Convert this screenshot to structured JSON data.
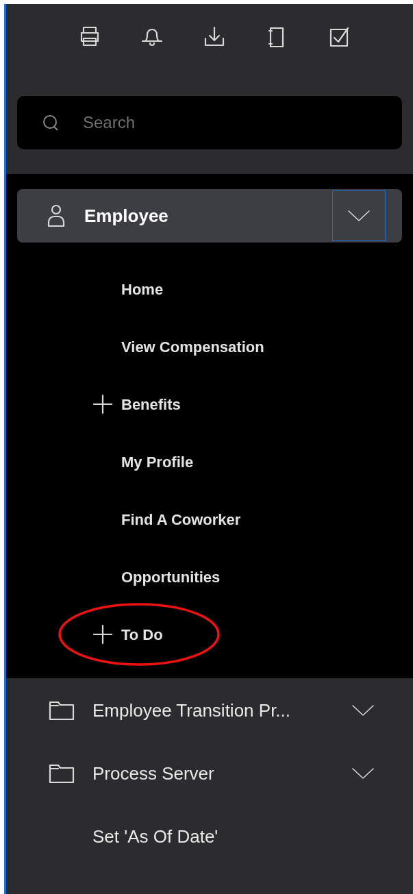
{
  "toolbar": [
    {
      "kind": "print"
    },
    {
      "kind": "bell"
    },
    {
      "kind": "download"
    },
    {
      "kind": "notebook"
    },
    {
      "kind": "checkbox"
    }
  ],
  "search": {
    "placeholder": "Search"
  },
  "nav": [
    {
      "label": "Employee",
      "kind": "person",
      "expanded": true,
      "children": [
        {
          "label": "Home",
          "kind": "link",
          "circled": false
        },
        {
          "label": "View Compensation",
          "kind": "link",
          "circled": false
        },
        {
          "label": "Benefits",
          "kind": "group",
          "circled": false
        },
        {
          "label": "My Profile",
          "kind": "link",
          "circled": false
        },
        {
          "label": "Find A Coworker",
          "kind": "link",
          "circled": false
        },
        {
          "label": "Opportunities",
          "kind": "link",
          "circled": false
        },
        {
          "label": "To Do",
          "kind": "group",
          "circled": true
        }
      ]
    },
    {
      "label": "Employee Transition Pr...",
      "kind": "folder",
      "expanded": false
    },
    {
      "label": "Process Server",
      "kind": "folder",
      "expanded": false
    },
    {
      "label": "Set 'As Of Date'",
      "kind": "link"
    }
  ]
}
